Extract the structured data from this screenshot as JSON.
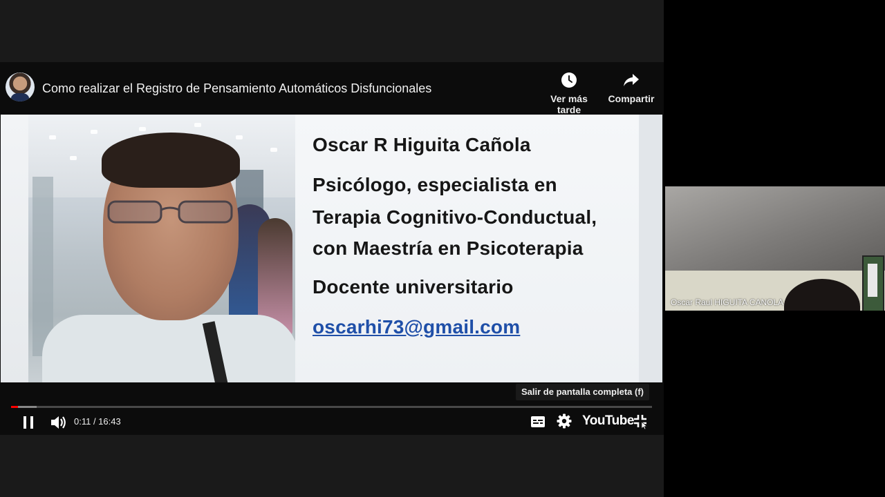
{
  "video": {
    "title": "Como realizar el Registro de Pensamiento Automáticos Disfuncionales",
    "channel_avatar_icon": "channel-avatar",
    "actions": {
      "watch_later_label": "Ver más tarde",
      "share_label": "Compartir"
    },
    "slide": {
      "name": "Oscar R Higuita Cañola",
      "role_line_1": "Psicólogo, especialista en",
      "role_line_2": "Terapia Cognitivo-Conductual,",
      "role_line_3": "con Maestría en Psicoterapia",
      "role_line_4": "Docente universitario",
      "email": "oscarhi73@gmail.com"
    },
    "tooltip": "Salir de pantalla completa (f)",
    "controls": {
      "time": "0:11 / 16:43",
      "current_seconds": 11,
      "duration_seconds": 1003,
      "buffered_fraction": 0.04,
      "youtube_label": "YouTube",
      "icons": [
        "pause-icon",
        "volume-icon",
        "subtitles-icon",
        "settings-icon",
        "exit-fullscreen-icon"
      ]
    },
    "colors": {
      "progress": "#ff0000",
      "email_link": "#1f4fa8"
    }
  },
  "participant": {
    "name": "Oscar Raul HIGUITA CANOLA"
  }
}
